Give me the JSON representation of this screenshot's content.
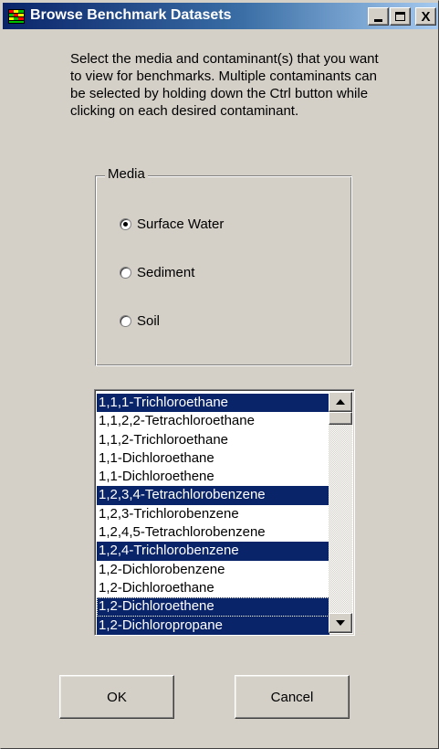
{
  "window": {
    "title": "Browse Benchmark Datasets",
    "controls": {
      "minimize": "_",
      "maximize": "□",
      "close": "X"
    },
    "icon": "app-icon"
  },
  "instructions": "Select the media and contaminant(s) that you want to view for benchmarks.  Multiple contaminants can be selected by holding down the Ctrl button while clicking on each desired contaminant.",
  "media": {
    "legend": "Media",
    "options": [
      {
        "label": "Surface Water",
        "checked": true
      },
      {
        "label": "Sediment",
        "checked": false
      },
      {
        "label": "Soil",
        "checked": false
      }
    ]
  },
  "contaminants": {
    "items": [
      {
        "label": "1,1,1-Trichloroethane",
        "selected": true
      },
      {
        "label": "1,1,2,2-Tetrachloroethane",
        "selected": false
      },
      {
        "label": "1,1,2-Trichloroethane",
        "selected": false
      },
      {
        "label": "1,1-Dichloroethane",
        "selected": false
      },
      {
        "label": "1,1-Dichloroethene",
        "selected": false
      },
      {
        "label": "1,2,3,4-Tetrachlorobenzene",
        "selected": true
      },
      {
        "label": "1,2,3-Trichlorobenzene",
        "selected": false
      },
      {
        "label": "1,2,4,5-Tetrachlorobenzene",
        "selected": false
      },
      {
        "label": "1,2,4-Trichlorobenzene",
        "selected": true
      },
      {
        "label": "1,2-Dichlorobenzene",
        "selected": false
      },
      {
        "label": "1,2-Dichloroethane",
        "selected": false
      },
      {
        "label": "1,2-Dichloroethene",
        "selected": true,
        "focused": true
      },
      {
        "label": "1,2-Dichloropropane",
        "selected": true
      }
    ]
  },
  "buttons": {
    "ok": "OK",
    "cancel": "Cancel"
  },
  "colors": {
    "titlebar_start": "#0a246a",
    "titlebar_end": "#a6caf0",
    "selection": "#0a246a",
    "face": "#d4d0c8"
  }
}
